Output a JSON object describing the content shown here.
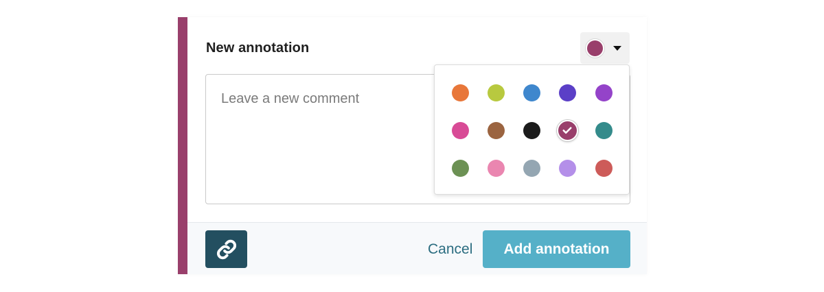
{
  "annotation": {
    "title": "New annotation",
    "selected_color": "#993f6b",
    "accent_color": "#993f6b"
  },
  "comment": {
    "placeholder": "Leave a new comment",
    "value": ""
  },
  "palette": {
    "rows": [
      [
        "#e8773a",
        "#b8c93f",
        "#3f87cd",
        "#5b3fc7",
        "#9443c9"
      ],
      [
        "#d84b96",
        "#9b6440",
        "#1b1b1b",
        "#993f6b",
        "#348b8b"
      ],
      [
        "#6c9154",
        "#ea86b0",
        "#94a6b2",
        "#b48fe9",
        "#cd5b59"
      ]
    ],
    "selected": [
      1,
      3
    ]
  },
  "footer": {
    "link_icon": "link-icon",
    "cancel_label": "Cancel",
    "add_label": "Add annotation"
  },
  "colors": {
    "link_button_bg": "#234f60",
    "add_button_bg": "#55b0c8",
    "cancel_text": "#2b6d80"
  }
}
